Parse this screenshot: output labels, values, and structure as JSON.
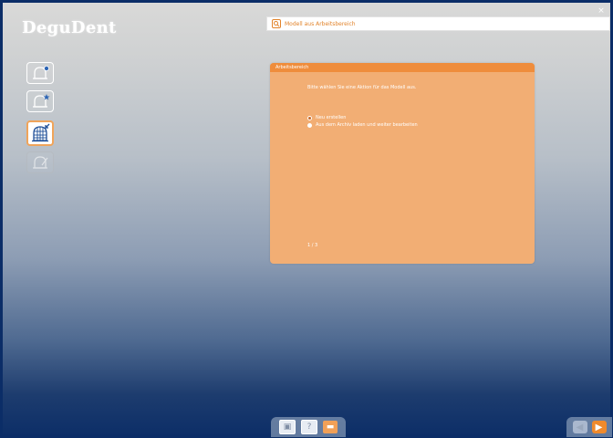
{
  "app": {
    "brand": "DeguDent"
  },
  "window": {
    "close_glyph": "×"
  },
  "topbar": {
    "icon": "search-icon",
    "text": "Modell aus Arbeitsbereich"
  },
  "sidebar": {
    "items": [
      {
        "icon": "bell-plus-icon",
        "state": "normal"
      },
      {
        "icon": "bell-star-icon",
        "state": "normal"
      },
      {
        "icon": "scanner-icon",
        "state": "active"
      },
      {
        "icon": "bell-edit-icon",
        "state": "disabled"
      }
    ]
  },
  "dialog": {
    "header": "Arbeitsbereich",
    "text": "Bitte wählen Sie eine Aktion für das Modell aus.",
    "options": [
      {
        "label": "Neu erstellen",
        "selected": true
      },
      {
        "label": "Aus dem Archiv laden und weiter bearbeiten",
        "selected": false
      }
    ],
    "footer": "1 / 3"
  },
  "toolbar": {
    "buttons": [
      {
        "icon": "save-icon",
        "glyph": "▣"
      },
      {
        "icon": "help-icon",
        "glyph": "?"
      },
      {
        "icon": "folder-icon",
        "glyph": "▬"
      }
    ]
  },
  "navigation": {
    "back_glyph": "◀",
    "next_glyph": "▶"
  },
  "colors": {
    "accent": "#f08a2c",
    "panel": "#f2ae74",
    "frame": "#0b2d67"
  }
}
